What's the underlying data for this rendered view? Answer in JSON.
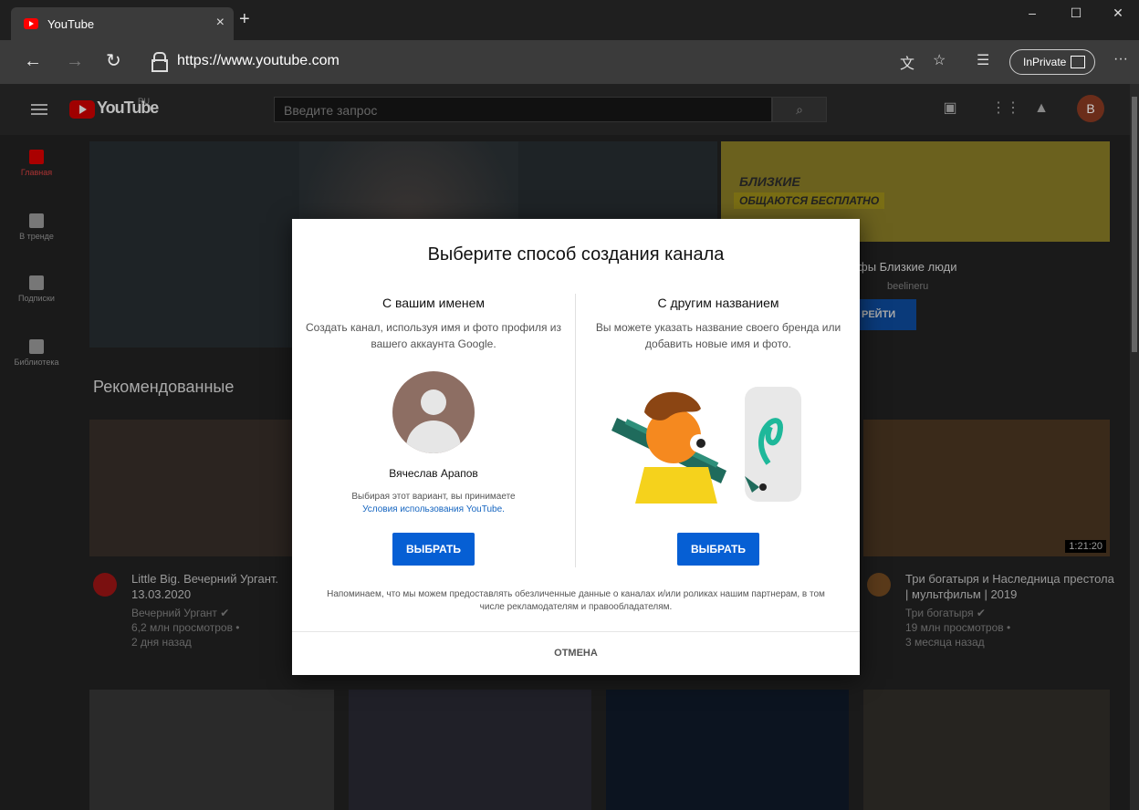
{
  "browser": {
    "tab_title": "YouTube",
    "tab_close": "×",
    "new_tab": "+",
    "url": "https://www.youtube.com",
    "inprivate_label": "InPrivate",
    "window_controls": [
      "–",
      "☐",
      "✕"
    ],
    "nav": {
      "back": "←",
      "forward": "→",
      "refresh": "↻"
    },
    "toolbar_more": "···"
  },
  "youtube": {
    "logo_text": "YouTube",
    "logo_region": "RU",
    "search_placeholder": "Введите запрос",
    "avatar_letter": "В",
    "sidebar": [
      {
        "label": "Главная",
        "active": true
      },
      {
        "label": "В тренде",
        "active": false
      },
      {
        "label": "Подписки",
        "active": false
      },
      {
        "label": "Библиотека",
        "active": false
      }
    ],
    "ad": {
      "line1": "БЛИЗКИЕ",
      "line2": "ОБЩАЮТСЯ БЕСПЛАТНО",
      "title": "фы Близкие люди",
      "channel": "beelineru",
      "button": "РЕЙТИ"
    },
    "recommended_title": "Рекомендованные",
    "videos": [
      {
        "title": "Little Big. Вечерний Ургант. 13.03.2020",
        "channel": "Вечерний Ургант ✔",
        "views": "6,2 млн просмотров •",
        "age": "2 дня назад"
      },
      {
        "title": "Три богатыря и Наследница престола | мультфильм | 2019",
        "channel": "Три богатыря ✔",
        "views": "19 млн просмотров •",
        "age": "3 месяца назад",
        "duration": "1:21:20"
      }
    ]
  },
  "dialog": {
    "title": "Выберите способ создания канала",
    "left": {
      "heading": "С вашим именем",
      "description": "Создать канал, используя имя и фото профиля из вашего аккаунта Google.",
      "user_name": "Вячеслав Арапов",
      "terms_prefix": "Выбирая этот вариант, вы принимаете",
      "terms_link": "Условия использования YouTube.",
      "button": "ВЫБРАТЬ"
    },
    "right": {
      "heading": "С другим названием",
      "description": "Вы можете указать название своего бренда или добавить новые имя и фото.",
      "button": "ВЫБРАТЬ"
    },
    "notice": "Напоминаем, что мы можем предоставлять обезличенные данные о каналах и/или роликах нашим партнерам, в том числе рекламодателям и правообладателям.",
    "cancel": "ОТМЕНА"
  }
}
